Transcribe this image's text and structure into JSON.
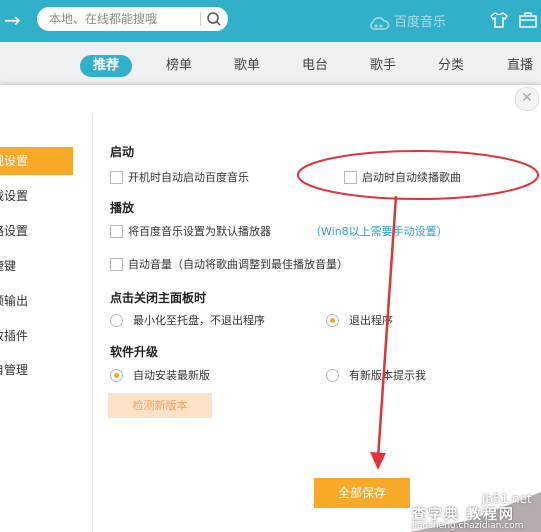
{
  "search": {
    "placeholder": "本地、在线都能搜哦"
  },
  "brand": {
    "name": "百度音乐"
  },
  "nav": {
    "tabs": [
      "推荐",
      "榜单",
      "歌单",
      "电台",
      "歌手",
      "分类",
      "直播"
    ],
    "active_index": 0
  },
  "sidebar": {
    "items": [
      "规设置",
      "载设置",
      "路设置",
      "捷键",
      "频输出",
      "放插件",
      "自管理"
    ],
    "active_index": 0
  },
  "settings": {
    "startup": {
      "title": "启动",
      "auto_start_label": "开机时自动启动百度音乐",
      "auto_resume_label": "启动时自动续播歌曲"
    },
    "playback": {
      "title": "播放",
      "default_player_label": "将百度音乐设置为默认播放器",
      "win8_note": "（Win8以上需要手动设置）",
      "auto_volume_label": "自动音量（自动将歌曲调整到最佳播放音量）"
    },
    "close_panel": {
      "title": "点击关闭主面板时",
      "minimize_label": "最小化至托盘，不退出程序",
      "exit_label": "退出程序",
      "selected": "exit"
    },
    "upgrade": {
      "title": "软件升级",
      "auto_install_label": "自动安装最新版",
      "notify_label": "有新版本提示我",
      "selected": "auto_install",
      "check_button": "检测新版本"
    }
  },
  "footer": {
    "save_button": "全部保存"
  },
  "watermark": {
    "line1": "jb51.net",
    "line2": "查字典 教程网",
    "line3": "jiaocheng.chazidian.com"
  },
  "colors": {
    "topbar": "#33b0c9",
    "accent": "#f8a928",
    "annotation": "#e0343a",
    "link": "#2c9fd6"
  }
}
